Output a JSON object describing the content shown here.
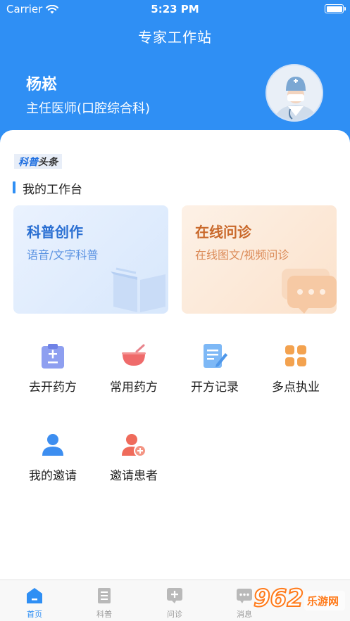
{
  "status_bar": {
    "carrier": "Carrier",
    "time": "5:23 PM"
  },
  "header": {
    "title": "专家工作站"
  },
  "doctor": {
    "name": "杨崧",
    "title": "主任医师(口腔综合科)"
  },
  "kepu_logo": {
    "part1": "科普",
    "part2": "头条"
  },
  "section": {
    "title": "我的工作台"
  },
  "cards": [
    {
      "title": "科普创作",
      "subtitle": "语音/文字科普"
    },
    {
      "title": "在线问诊",
      "subtitle": "在线图文/视频问诊"
    }
  ],
  "grid": [
    {
      "label": "去开药方",
      "icon": "prescription-icon"
    },
    {
      "label": "常用药方",
      "icon": "medicine-bowl-icon"
    },
    {
      "label": "开方记录",
      "icon": "record-icon"
    },
    {
      "label": "多点执业",
      "icon": "apps-icon"
    },
    {
      "label": "我的邀请",
      "icon": "user-icon"
    },
    {
      "label": "邀请患者",
      "icon": "add-user-icon"
    }
  ],
  "tabbar": [
    {
      "label": "首页",
      "icon": "home-icon",
      "active": true
    },
    {
      "label": "科普",
      "icon": "article-icon",
      "active": false
    },
    {
      "label": "问诊",
      "icon": "consult-icon",
      "active": false
    },
    {
      "label": "消息",
      "icon": "message-icon",
      "active": false
    }
  ],
  "watermark": {
    "text": "962",
    "site": "乐游网"
  },
  "colors": {
    "primary": "#2f8ff4",
    "orange": "#c9682a",
    "tab_inactive": "#999999"
  }
}
